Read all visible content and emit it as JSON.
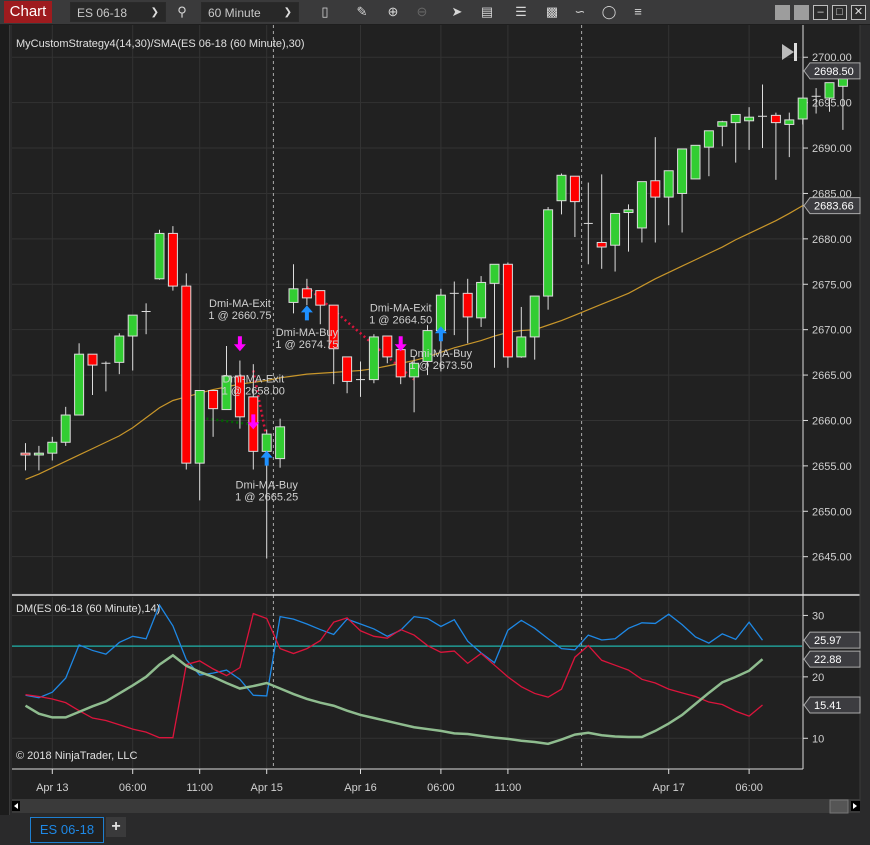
{
  "toolbar": {
    "app_badge": "Chart",
    "instrument": "ES 06-18",
    "interval": "60 Minute",
    "icons": [
      "search-icon",
      "bar-type-icon",
      "pencil-draw-icon",
      "zoom-in-icon",
      "zoom-out-icon",
      "pointer-icon",
      "data-box-icon",
      "chart-trader-icon",
      "templates-icon",
      "strategies-icon",
      "indicator-icon",
      "properties-list-icon"
    ],
    "window_icons": [
      "snap-left-icon",
      "snap-right-icon",
      "minimize-icon",
      "maximize-icon",
      "close-icon"
    ]
  },
  "tabs": [
    {
      "label": "ES 06-18",
      "active": true
    }
  ],
  "add_tab_label": "+",
  "colors": {
    "up": "#32cd32",
    "down": "#ff0000",
    "sma": "#c8962a",
    "plus_di": "#1e88e5",
    "minus_di": "#dc143c",
    "adx": "#8fbc8f",
    "level": "#20b2aa",
    "buy_arrow": "#1e90ff",
    "exit_arrow": "#ff00ff",
    "background": "#212121"
  },
  "chart_data": [
    {
      "type": "candlestick",
      "title": "MyCustomStrategy4(14,30)/SMA(ES 06-18 (60 Minute),30)",
      "ylim": [
        2641,
        2703
      ],
      "yticks": [
        "2645.00",
        "2650.00",
        "2655.00",
        "2660.00",
        "2665.00",
        "2670.00",
        "2675.00",
        "2680.00",
        "2685.00",
        "2690.00",
        "2695.00",
        "2700.00"
      ],
      "xtick_labels": [
        {
          "label": "Apr 13",
          "bar": 2
        },
        {
          "label": "06:00",
          "bar": 8
        },
        {
          "label": "11:00",
          "bar": 13
        },
        {
          "label": "Apr 15",
          "bar": 18
        },
        {
          "label": "Apr 16",
          "bar": 25
        },
        {
          "label": "06:00",
          "bar": 31
        },
        {
          "label": "11:00",
          "bar": 36
        },
        {
          "label": "Apr 17",
          "bar": 48
        },
        {
          "label": "06:00",
          "bar": 54
        }
      ],
      "session_breaks": [
        18.5,
        41.5
      ],
      "candles": [
        {
          "o": 2656.4,
          "h": 2657.5,
          "l": 2654.5,
          "c": 2656.2
        },
        {
          "o": 2656.2,
          "h": 2657.2,
          "l": 2654.5,
          "c": 2656.4
        },
        {
          "o": 2656.4,
          "h": 2658.2,
          "l": 2655.6,
          "c": 2657.6
        },
        {
          "o": 2657.6,
          "h": 2661.5,
          "l": 2657.2,
          "c": 2660.6
        },
        {
          "o": 2660.6,
          "h": 2668.5,
          "l": 2660.6,
          "c": 2667.3
        },
        {
          "o": 2667.3,
          "h": 2667.3,
          "l": 2662.8,
          "c": 2666.1
        },
        {
          "o": 2666.2,
          "h": 2666.5,
          "l": 2663.2,
          "c": 2666.3
        },
        {
          "o": 2666.4,
          "h": 2669.6,
          "l": 2665.1,
          "c": 2669.3
        },
        {
          "o": 2669.3,
          "h": 2671.6,
          "l": 2665.5,
          "c": 2671.6
        },
        {
          "o": 2672.0,
          "h": 2672.9,
          "l": 2669.5,
          "c": 2672.0
        },
        {
          "o": 2675.6,
          "h": 2681.0,
          "l": 2675.5,
          "c": 2680.6
        },
        {
          "o": 2680.6,
          "h": 2681.4,
          "l": 2674.3,
          "c": 2674.8
        },
        {
          "o": 2674.8,
          "h": 2676.2,
          "l": 2654.6,
          "c": 2655.3
        },
        {
          "o": 2655.3,
          "h": 2660.2,
          "l": 2651.2,
          "c": 2663.3
        },
        {
          "o": 2663.3,
          "h": 2663.3,
          "l": 2658.2,
          "c": 2661.3
        },
        {
          "o": 2661.2,
          "h": 2668.2,
          "l": 2661.2,
          "c": 2664.9
        },
        {
          "o": 2664.9,
          "h": 2666.6,
          "l": 2659.1,
          "c": 2660.4
        },
        {
          "o": 2662.6,
          "h": 2666.2,
          "l": 2654.6,
          "c": 2656.6
        },
        {
          "o": 2656.6,
          "h": 2659.0,
          "l": 2644.8,
          "c": 2658.5
        },
        {
          "o": 2655.8,
          "h": 2660.2,
          "l": 2654.8,
          "c": 2659.3
        },
        {
          "o": 2673.0,
          "h": 2677.2,
          "l": 2671.8,
          "c": 2674.5
        },
        {
          "o": 2674.5,
          "h": 2675.6,
          "l": 2672.7,
          "c": 2673.5
        },
        {
          "o": 2674.3,
          "h": 2674.3,
          "l": 2670.6,
          "c": 2672.7
        },
        {
          "o": 2672.7,
          "h": 2672.7,
          "l": 2664.0,
          "c": 2667.9
        },
        {
          "o": 2667.0,
          "h": 2667.0,
          "l": 2663.0,
          "c": 2664.3
        },
        {
          "o": 2664.5,
          "h": 2666.5,
          "l": 2662.6,
          "c": 2664.5
        },
        {
          "o": 2664.5,
          "h": 2669.5,
          "l": 2664.1,
          "c": 2669.2
        },
        {
          "o": 2669.3,
          "h": 2669.3,
          "l": 2666.3,
          "c": 2667.0
        },
        {
          "o": 2667.8,
          "h": 2668.4,
          "l": 2664.0,
          "c": 2664.8
        },
        {
          "o": 2664.8,
          "h": 2667.1,
          "l": 2660.9,
          "c": 2666.3
        },
        {
          "o": 2666.5,
          "h": 2670.5,
          "l": 2665.0,
          "c": 2669.9
        },
        {
          "o": 2669.9,
          "h": 2674.5,
          "l": 2665.4,
          "c": 2673.8
        },
        {
          "o": 2674.0,
          "h": 2675.3,
          "l": 2669.4,
          "c": 2674.0
        },
        {
          "o": 2674.0,
          "h": 2675.6,
          "l": 2668.5,
          "c": 2671.4
        },
        {
          "o": 2671.3,
          "h": 2675.9,
          "l": 2670.3,
          "c": 2675.2
        },
        {
          "o": 2675.1,
          "h": 2675.3,
          "l": 2665.8,
          "c": 2677.2
        },
        {
          "o": 2677.2,
          "h": 2677.4,
          "l": 2665.8,
          "c": 2667.0
        },
        {
          "o": 2667.0,
          "h": 2672.5,
          "l": 2666.9,
          "c": 2669.2
        },
        {
          "o": 2669.2,
          "h": 2671.6,
          "l": 2666.7,
          "c": 2673.7
        },
        {
          "o": 2673.7,
          "h": 2683.5,
          "l": 2672.2,
          "c": 2683.2
        },
        {
          "o": 2684.2,
          "h": 2687.2,
          "l": 2682.7,
          "c": 2687.0
        },
        {
          "o": 2686.9,
          "h": 2686.9,
          "l": 2680.2,
          "c": 2684.1
        },
        {
          "o": 2681.7,
          "h": 2686.2,
          "l": 2677.2,
          "c": 2681.7
        },
        {
          "o": 2679.6,
          "h": 2687.1,
          "l": 2676.7,
          "c": 2679.1
        },
        {
          "o": 2679.3,
          "h": 2681.0,
          "l": 2676.4,
          "c": 2682.8
        },
        {
          "o": 2682.9,
          "h": 2683.8,
          "l": 2678.6,
          "c": 2683.2
        },
        {
          "o": 2681.2,
          "h": 2686.0,
          "l": 2679.6,
          "c": 2686.3
        },
        {
          "o": 2686.4,
          "h": 2691.2,
          "l": 2679.6,
          "c": 2684.6
        },
        {
          "o": 2684.6,
          "h": 2684.9,
          "l": 2681.5,
          "c": 2687.5
        },
        {
          "o": 2685.0,
          "h": 2685.9,
          "l": 2680.7,
          "c": 2689.9
        },
        {
          "o": 2686.6,
          "h": 2690.2,
          "l": 2689.9,
          "c": 2690.3
        },
        {
          "o": 2690.1,
          "h": 2690.6,
          "l": 2686.9,
          "c": 2691.9
        },
        {
          "o": 2692.4,
          "h": 2693.0,
          "l": 2690.2,
          "c": 2692.9
        },
        {
          "o": 2692.8,
          "h": 2693.1,
          "l": 2688.4,
          "c": 2693.7
        },
        {
          "o": 2693.0,
          "h": 2694.5,
          "l": 2689.8,
          "c": 2693.4
        },
        {
          "o": 2693.4,
          "h": 2697.0,
          "l": 2690.0,
          "c": 2693.5
        },
        {
          "o": 2693.6,
          "h": 2693.9,
          "l": 2686.5,
          "c": 2692.8
        },
        {
          "o": 2692.6,
          "h": 2693.9,
          "l": 2689.0,
          "c": 2693.1
        },
        {
          "o": 2693.2,
          "h": 2695.2,
          "l": 2692.6,
          "c": 2695.5
        },
        {
          "o": 2695.7,
          "h": 2696.6,
          "l": 2693.8,
          "c": 2695.7
        },
        {
          "o": 2695.5,
          "h": 2697.0,
          "l": 2694.0,
          "c": 2697.2
        },
        {
          "o": 2696.8,
          "h": 2699.0,
          "l": 2692.0,
          "c": 2698.5
        }
      ],
      "sma_values": [
        2653.5,
        2654.1,
        2654.8,
        2655.5,
        2656.2,
        2656.9,
        2657.6,
        2658.3,
        2659.2,
        2660.3,
        2661.4,
        2662.2,
        2662.6,
        2663.0,
        2663.4,
        2663.7,
        2664.0,
        2664.2,
        2664.4,
        2664.7,
        2664.9,
        2665.1,
        2665.2,
        2665.3,
        2665.4,
        2665.5,
        2665.7,
        2666.0,
        2666.3,
        2666.6,
        2667.0,
        2667.5,
        2668.0,
        2668.4,
        2668.8,
        2669.3,
        2669.7,
        2669.9,
        2670.0,
        2670.5,
        2671.0,
        2671.6,
        2672.2,
        2672.8,
        2673.4,
        2674.0,
        2674.8,
        2675.6,
        2676.3,
        2677.0,
        2677.7,
        2678.4,
        2679.1,
        2679.9,
        2680.6,
        2681.3,
        2682.0,
        2682.8,
        2683.66
      ],
      "sma_start_bar": 0,
      "sma_label": "2683.66",
      "last_price_label": "2698.50",
      "trades": [
        {
          "bar": 16,
          "label": "Dmi-MA-Exit",
          "detail": "1 @ 2660.75",
          "kind": "exit",
          "arrow_price": 2668.5,
          "label_price": 2672.5
        },
        {
          "bar": 17,
          "label": "Dmi-MA-Exit",
          "detail": "1 @ 2658.00",
          "kind": "exit",
          "arrow_price": 2659.9,
          "label_price": 2664.2
        },
        {
          "bar": 18,
          "label": "Dmi-MA-Buy",
          "detail": "1 @ 2665.25",
          "kind": "buy",
          "arrow_price": 2655.8,
          "label_price": 2652.5
        },
        {
          "bar": 21,
          "label": "Dmi-MA-Buy",
          "detail": "1 @ 2674.75",
          "kind": "buy",
          "arrow_price": 2671.8,
          "label_price": 2669.3
        },
        {
          "bar": 28,
          "label": "Dmi-MA-Exit",
          "detail": "1 @ 2664.50",
          "kind": "exit",
          "arrow_price": 2668.5,
          "label_price": 2672.0
        },
        {
          "bar": 31,
          "label": "Dmi-MA-Buy",
          "detail": "1 @ 2673.50",
          "kind": "buy",
          "arrow_price": 2669.5,
          "label_price": 2667.0
        }
      ],
      "trade_lines": [
        {
          "from_bar": 13.5,
          "from_price": 2660.2,
          "to_bar": 17.3,
          "to_price": 2659.5,
          "color": "#006400"
        },
        {
          "from_bar": 17,
          "from_price": 2665.5,
          "to_bar": 18,
          "to_price": 2658.0,
          "color": "#dc143c"
        },
        {
          "from_bar": 21,
          "from_price": 2674.7,
          "to_bar": 29,
          "to_price": 2664.5,
          "color": "#dc143c"
        }
      ]
    },
    {
      "type": "line",
      "title": "DM(ES 06-18 (60 Minute),14)",
      "ylim": [
        5,
        33
      ],
      "yticks": [
        "10",
        "20",
        "30"
      ],
      "level": 25.0,
      "series": [
        {
          "name": "+DI",
          "values": [
            17.0,
            16.6,
            17.5,
            19.8,
            25.2,
            24.3,
            23.7,
            25.6,
            26.6,
            26.2,
            31.7,
            28.3,
            22.8,
            20.3,
            20.6,
            21.1,
            19.6,
            17.0,
            16.9,
            29.8,
            29.4,
            28.6,
            27.7,
            26.9,
            29.4,
            28.6,
            27.8,
            26.6,
            27.6,
            29.8,
            29.5,
            28.2,
            29.3,
            25.8,
            23.9,
            22.3,
            27.6,
            29.2,
            27.9,
            26.2,
            24.6,
            24.4,
            26.8,
            26.0,
            26.2,
            27.9,
            28.8,
            28.7,
            30.2,
            28.5,
            26.5,
            25.5,
            27.0,
            26.1,
            28.9,
            25.97
          ],
          "label": "25.97"
        },
        {
          "name": "-DI",
          "values": [
            17.1,
            16.8,
            16.4,
            15.8,
            14.5,
            13.3,
            12.9,
            12.2,
            11.5,
            11.0,
            10.1,
            10.1,
            22.0,
            22.6,
            21.3,
            20.2,
            21.5,
            30.3,
            29.5,
            24.6,
            23.8,
            24.6,
            25.9,
            28.9,
            29.6,
            27.5,
            26.6,
            26.3,
            27.7,
            26.8,
            25.1,
            24.0,
            24.2,
            22.2,
            23.8,
            21.9,
            20.0,
            18.4,
            17.3,
            16.7,
            18.0,
            23.2,
            25.1,
            22.7,
            21.9,
            21.1,
            19.6,
            19.0,
            18.0,
            17.4,
            16.8,
            15.9,
            15.5,
            14.4,
            13.6,
            15.41
          ],
          "label": "15.41"
        },
        {
          "name": "ADX",
          "values": [
            15.3,
            14.0,
            13.4,
            13.4,
            14.3,
            15.2,
            16.0,
            17.3,
            18.6,
            20.0,
            22.0,
            23.5,
            21.8,
            20.8,
            20.0,
            19.0,
            18.1,
            18.5,
            19.0,
            18.1,
            17.2,
            16.4,
            15.8,
            15.3,
            14.5,
            13.8,
            13.3,
            12.8,
            12.3,
            11.8,
            11.5,
            11.2,
            10.8,
            10.7,
            10.4,
            10.1,
            9.9,
            9.6,
            9.4,
            9.1,
            9.8,
            10.6,
            10.9,
            10.5,
            10.3,
            10.2,
            10.2,
            11.2,
            12.4,
            13.8,
            15.6,
            17.4,
            19.1,
            20.0,
            21.0,
            22.88
          ],
          "label": "22.88"
        }
      ]
    }
  ],
  "copyright": "© 2018 NinjaTrader, LLC"
}
